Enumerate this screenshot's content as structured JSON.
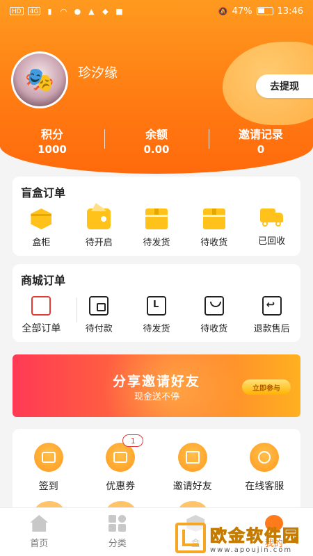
{
  "status_bar": {
    "chips": [
      "HD",
      "4G"
    ],
    "battery": "47%",
    "time": "13:46"
  },
  "profile": {
    "username": "珍汐缘",
    "withdraw_label": "去提现"
  },
  "stats": [
    {
      "label": "积分",
      "value": "1000"
    },
    {
      "label": "余额",
      "value": "0.00"
    },
    {
      "label": "邀请记录",
      "value": "0"
    }
  ],
  "blind_box_orders": {
    "title": "盲盒订单",
    "items": [
      {
        "label": "盒柜",
        "icon": "cube-icon"
      },
      {
        "label": "待开启",
        "icon": "bag-icon"
      },
      {
        "label": "待发货",
        "icon": "package-icon"
      },
      {
        "label": "待收货",
        "icon": "package-icon"
      },
      {
        "label": "已回收",
        "icon": "truck-icon"
      }
    ]
  },
  "mall_orders": {
    "title": "商城订单",
    "all_label": "全部订单",
    "items": [
      {
        "label": "待付款",
        "icon": "wallet-icon"
      },
      {
        "label": "待发货",
        "icon": "document-icon"
      },
      {
        "label": "待收货",
        "icon": "basket-icon"
      },
      {
        "label": "退款售后",
        "icon": "return-icon"
      }
    ]
  },
  "banner": {
    "title": "分享邀请好友",
    "subtitle": "现金送不停",
    "button": "立即参与",
    "colors": [
      "#ff3a55",
      "#ffb020"
    ]
  },
  "services": [
    {
      "label": "签到",
      "icon": "checkin-icon",
      "badge": null
    },
    {
      "label": "优惠券",
      "icon": "coupon-icon",
      "badge": "1"
    },
    {
      "label": "邀请好友",
      "icon": "gift-icon",
      "badge": null
    },
    {
      "label": "在线客服",
      "icon": "customer-service-icon",
      "badge": null
    }
  ],
  "tabbar": [
    {
      "label": "首页",
      "icon": "home-icon"
    },
    {
      "label": "分类",
      "icon": "category-icon"
    },
    {
      "label": "盒",
      "icon": "box-icon"
    },
    {
      "label": "我的",
      "icon": "profile-icon"
    }
  ],
  "watermark": {
    "brand": "欧金软件园",
    "url": "www.apoujin.com"
  },
  "colors": {
    "accent": "#ff7a12",
    "icon_yellow": "#ffc21a",
    "badge_red": "#e53935"
  }
}
